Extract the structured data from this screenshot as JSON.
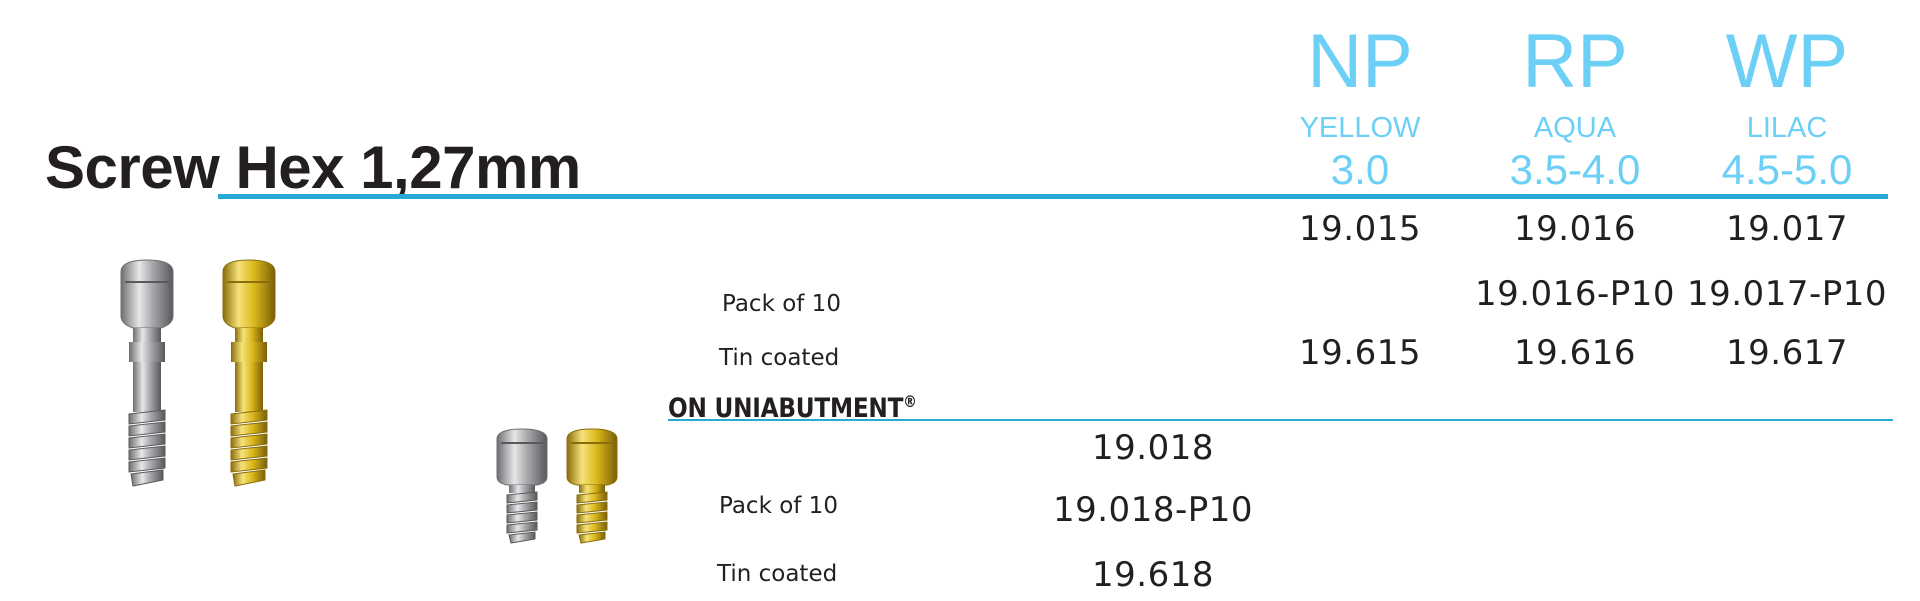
{
  "title": "Screw Hex 1,27mm",
  "platforms": [
    {
      "code": "NP",
      "color_name": "YELLOW",
      "diameter": "3.0"
    },
    {
      "code": "RP",
      "color_name": "AQUA",
      "diameter": "3.5-4.0"
    },
    {
      "code": "WP",
      "color_name": "LILAC",
      "diameter": "4.5-5.0"
    }
  ],
  "main_table": {
    "rows": [
      {
        "label": "",
        "values": [
          "19.015",
          "19.016",
          "19.017"
        ]
      },
      {
        "label": "Pack of 10",
        "values": [
          "",
          "19.016-P10",
          "19.017-P10"
        ]
      },
      {
        "label": "Tin coated",
        "values": [
          "19.615",
          "19.616",
          "19.617"
        ]
      }
    ]
  },
  "uniabutment": {
    "heading": "ON UNIABUTMENT",
    "heading_mark": "®",
    "rows": [
      {
        "label": "",
        "value": "19.018"
      },
      {
        "label": "Pack of 10",
        "value": "19.018-P10"
      },
      {
        "label": "Tin coated",
        "value": "19.618"
      }
    ]
  },
  "colors": {
    "accent": "#6ccff6",
    "rule": "#27a9d8",
    "text": "#231f20",
    "titanium": "#a7a9ac",
    "tin_gold": "#d9b81c"
  },
  "illustrations": [
    "titanium-screw-long",
    "gold-screw-long",
    "titanium-screw-short",
    "gold-screw-short"
  ]
}
